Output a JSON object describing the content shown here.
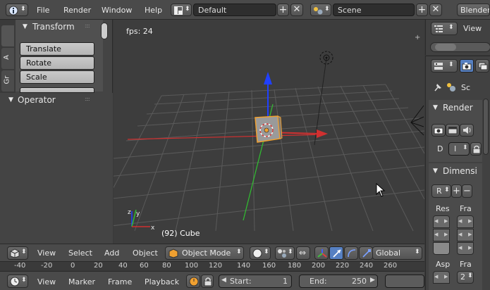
{
  "top_bar": {
    "menus": [
      "File",
      "Render",
      "Window",
      "Help"
    ],
    "layout_value": "Default",
    "scene_value": "Scene",
    "engine_label": "Blender"
  },
  "tool_shelf": {
    "side_tabs": [
      "A",
      "Gr"
    ],
    "transform_header": "Transform",
    "buttons": [
      "Translate",
      "Rotate",
      "Scale"
    ],
    "operator_header": "Operator"
  },
  "viewport": {
    "fps_text": "fps: 24",
    "object_info": "(92) Cube"
  },
  "header_3d": {
    "menus": [
      "View",
      "Select",
      "Add",
      "Object"
    ],
    "mode": "Object Mode",
    "orientation": "Global"
  },
  "timeline_ruler": {
    "ticks": [
      "-40",
      "-20",
      "0",
      "20",
      "40",
      "60",
      "80",
      "100",
      "120",
      "140",
      "160",
      "180",
      "200",
      "220",
      "240",
      "260"
    ]
  },
  "timeline_header": {
    "menus": [
      "View",
      "Marker",
      "Frame",
      "Playback"
    ],
    "start_label": "Start:",
    "start_value": "1",
    "end_label": "End:",
    "end_value": "250"
  },
  "outliner": {
    "view_label": "View"
  },
  "properties": {
    "scene_short": "Sc",
    "render_header": "Render",
    "display_short": "D",
    "display_value": "I",
    "dimensions_header": "Dimensi",
    "preset_value": "R",
    "res_label": "Res",
    "fra_label": "Fra",
    "asp_label": "Asp",
    "fra2_label": "Fra",
    "fra2_value": "2"
  },
  "colors": {
    "background": "#393939",
    "viewport": "#3d3d3d",
    "selection_orange": "#f0a030",
    "x_axis": "#d03030",
    "y_axis": "#30c030",
    "z_axis": "#2040ff"
  }
}
